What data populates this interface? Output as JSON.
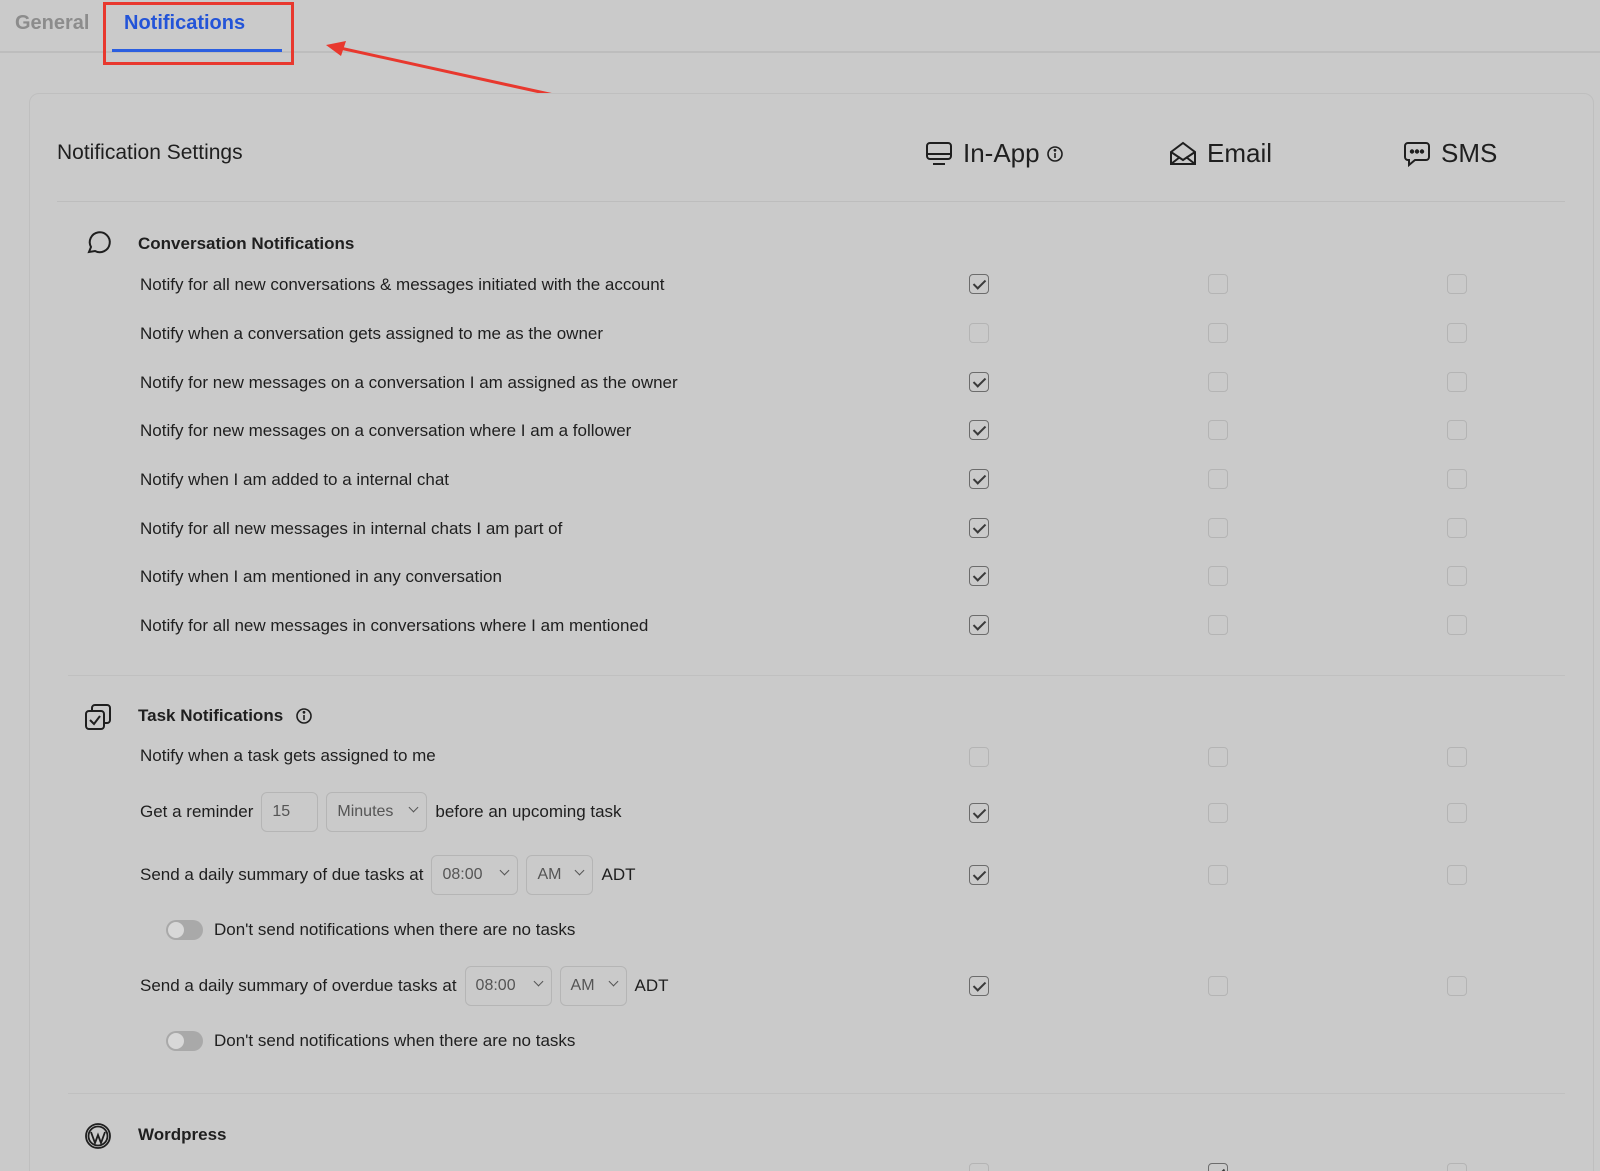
{
  "tabs": {
    "general": "General",
    "notifications": "Notifications"
  },
  "header": {
    "title": "Notification Settings",
    "col_inapp": "In-App",
    "col_email": "Email",
    "col_sms": "SMS"
  },
  "colors": {
    "active_tab": "#2354d8",
    "annotation": "#e8382e",
    "background": "#cacaca"
  },
  "conversation": {
    "title": "Conversation Notifications",
    "rows": [
      {
        "label": "Notify for all new conversations & messages initiated with the account",
        "inapp": true,
        "email": false,
        "sms": false
      },
      {
        "label": "Notify when a conversation gets assigned to me as the owner",
        "inapp": false,
        "email": false,
        "sms": false
      },
      {
        "label": "Notify for new messages on a conversation I am assigned as the owner",
        "inapp": true,
        "email": false,
        "sms": false
      },
      {
        "label": "Notify for new messages on a conversation where I am a follower",
        "inapp": true,
        "email": false,
        "sms": false
      },
      {
        "label": "Notify when I am added to a internal chat",
        "inapp": true,
        "email": false,
        "sms": false
      },
      {
        "label": "Notify for all new messages in internal chats I am part of",
        "inapp": true,
        "email": false,
        "sms": false
      },
      {
        "label": "Notify when I am mentioned in any conversation",
        "inapp": true,
        "email": false,
        "sms": false
      },
      {
        "label": "Notify for all new messages in conversations where I am mentioned",
        "inapp": true,
        "email": false,
        "sms": false
      }
    ]
  },
  "tasks": {
    "title": "Task Notifications",
    "assigned_label": "Notify when a task gets assigned to me",
    "reminder": {
      "prefix": "Get a reminder",
      "value": "15",
      "unit": "Minutes",
      "suffix": "before an upcoming task"
    },
    "due_summary": {
      "prefix": "Send a daily summary of due tasks at",
      "time": "08:00",
      "ampm": "AM",
      "tz": "ADT"
    },
    "overdue_summary": {
      "prefix": "Send a daily summary of overdue tasks at",
      "time": "08:00",
      "ampm": "AM",
      "tz": "ADT"
    },
    "no_tasks_toggle_label": "Don't send notifications when there are no tasks",
    "checks": [
      {
        "inapp": false,
        "email": false,
        "sms": false
      },
      {
        "inapp": true,
        "email": false,
        "sms": false
      },
      {
        "inapp": true,
        "email": false,
        "sms": false
      },
      {
        "inapp": true,
        "email": false,
        "sms": false
      }
    ]
  },
  "wordpress": {
    "title": "Wordpress"
  }
}
